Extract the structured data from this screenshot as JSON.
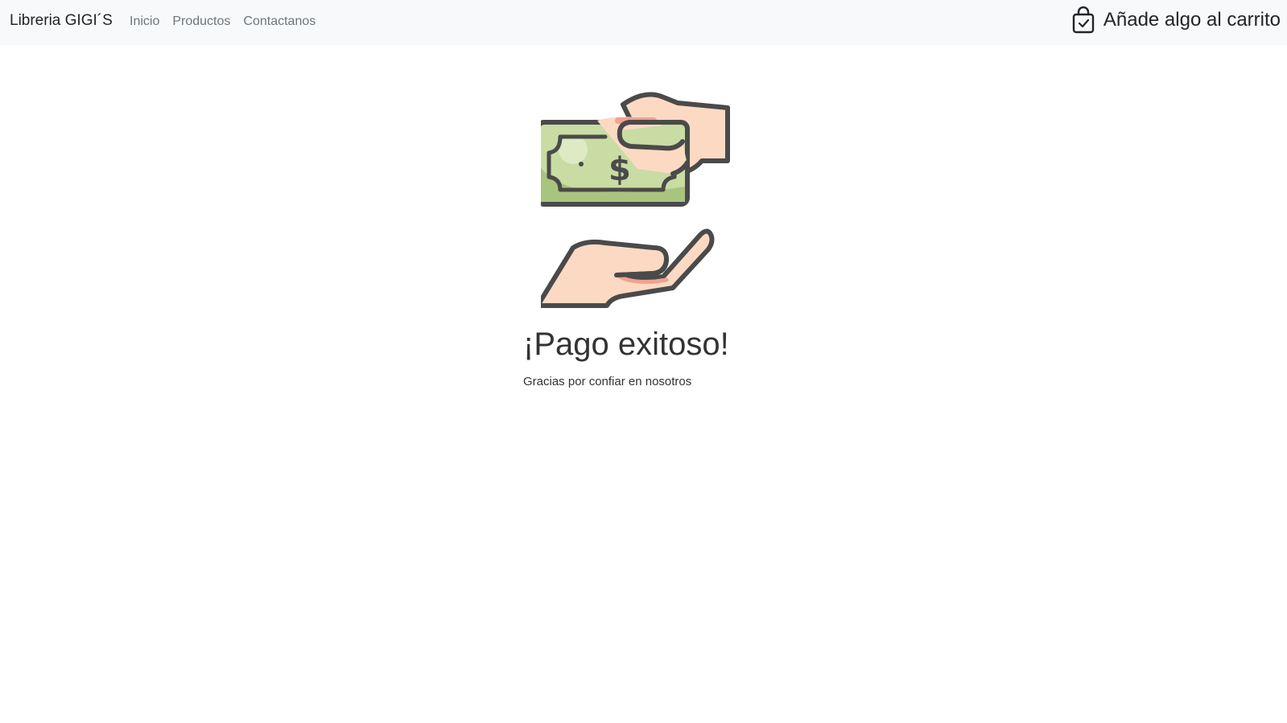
{
  "navbar": {
    "brand": "Libreria GIGI´S",
    "links": [
      "Inicio",
      "Productos",
      "Contactanos"
    ],
    "cart_label": "Añade algo al carrito",
    "cart_icon": "shopping-bag-check-icon"
  },
  "main": {
    "illustration_icon": "payment-hands-money-icon",
    "title": "¡Pago exitoso!",
    "subtitle": "Gracias por confiar en nosotros"
  },
  "colors": {
    "navbar_bg": "#f8f9fa",
    "bill_green": "#c8dca3",
    "bill_dark_green": "#a9c47f",
    "skin": "#fcd9c3",
    "skin_shadow": "#f0a28e",
    "outline": "#4a4a4a"
  }
}
